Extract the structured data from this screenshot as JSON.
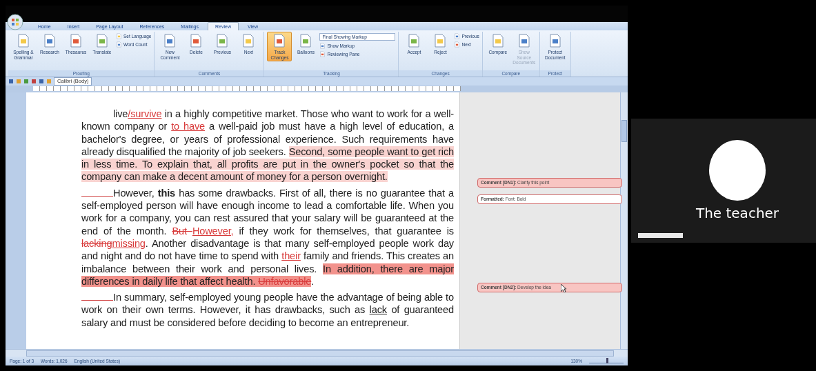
{
  "word_window": {
    "tabs": [
      {
        "label": "Home",
        "selected": false
      },
      {
        "label": "Insert",
        "selected": false
      },
      {
        "label": "Page Layout",
        "selected": false
      },
      {
        "label": "References",
        "selected": false
      },
      {
        "label": "Mailings",
        "selected": false
      },
      {
        "label": "Review",
        "selected": true
      },
      {
        "label": "View",
        "selected": false
      }
    ],
    "ribbon_groups": [
      {
        "label": "Proofing",
        "buttons": [
          {
            "label": "Spelling & Grammar",
            "kind": "large",
            "selected": false,
            "disabled": false
          },
          {
            "label": "Research",
            "kind": "large",
            "selected": false,
            "disabled": false
          },
          {
            "label": "Thesaurus",
            "kind": "large",
            "selected": false,
            "disabled": false
          },
          {
            "label": "Translate",
            "kind": "large",
            "selected": false,
            "disabled": false
          },
          {
            "label": "Set Language",
            "kind": "small",
            "selected": false,
            "disabled": false
          },
          {
            "label": "Word Count",
            "kind": "small",
            "selected": false,
            "disabled": false
          }
        ]
      },
      {
        "label": "Comments",
        "buttons": [
          {
            "label": "New Comment",
            "kind": "large",
            "selected": false,
            "disabled": false
          },
          {
            "label": "Delete",
            "kind": "large",
            "selected": false,
            "disabled": false
          },
          {
            "label": "Previous",
            "kind": "large",
            "selected": false,
            "disabled": false
          },
          {
            "label": "Next",
            "kind": "large",
            "selected": false,
            "disabled": false
          }
        ]
      },
      {
        "label": "Tracking",
        "buttons": [
          {
            "label": "Track Changes",
            "kind": "large",
            "selected": true,
            "disabled": false
          },
          {
            "label": "Balloons",
            "kind": "large",
            "selected": false,
            "disabled": false
          },
          {
            "label": "Final Showing Markup",
            "kind": "dropdown",
            "selected": false,
            "disabled": false
          },
          {
            "label": "Show Markup",
            "kind": "small",
            "selected": false,
            "disabled": false
          },
          {
            "label": "Reviewing Pane",
            "kind": "small",
            "selected": false,
            "disabled": false
          }
        ]
      },
      {
        "label": "Changes",
        "buttons": [
          {
            "label": "Accept",
            "kind": "large",
            "selected": false,
            "disabled": false
          },
          {
            "label": "Reject",
            "kind": "large",
            "selected": false,
            "disabled": false
          },
          {
            "label": "Previous",
            "kind": "small",
            "selected": false,
            "disabled": false
          },
          {
            "label": "Next",
            "kind": "small",
            "selected": false,
            "disabled": false
          }
        ]
      },
      {
        "label": "Compare",
        "buttons": [
          {
            "label": "Compare",
            "kind": "large",
            "selected": false,
            "disabled": false
          },
          {
            "label": "Show Source Documents",
            "kind": "large",
            "selected": false,
            "disabled": true
          }
        ]
      },
      {
        "label": "Protect",
        "buttons": [
          {
            "label": "Protect Document",
            "kind": "large",
            "selected": false,
            "disabled": false
          }
        ]
      }
    ],
    "font_box": "Calibri (Body)",
    "paragraphs": [
      {
        "indent": false,
        "segments": [
          {
            "text": "live",
            "kind": "text"
          },
          {
            "text": "/survive",
            "kind": "ins"
          },
          {
            "text": " in a highly competitive market. Those who want to work for a well-known company or ",
            "kind": "text"
          },
          {
            "text": "to have",
            "kind": "ins"
          },
          {
            "text": " a well-paid job must have a high level of education, a bachelor's degree, or years of professional experience. Such requirements have already disqualified the majority of job seekers. ",
            "kind": "text"
          },
          {
            "text": "Second, some people want to get rich in less time. To explain that, all profits are put in the owner's pocket so that the company can make a decent amount of money for a person overnight.",
            "kind": "text",
            "color": "#f9d3d0"
          }
        ]
      },
      {
        "indent": true,
        "segments": [
          {
            "text": "However, ",
            "kind": "text"
          },
          {
            "text": "this",
            "kind": "bold"
          },
          {
            "text": " has some drawbacks. First of all, there is no guarantee that a self-employed person will have enough income to lead a comfortable life. When you work for a company, you can rest assured that your salary will be guaranteed at the end of the month. ",
            "kind": "text"
          },
          {
            "text": "But ",
            "kind": "del"
          },
          {
            "text": "However,",
            "kind": "ins"
          },
          {
            "text": " if they work for themselves, that guarantee is ",
            "kind": "text"
          },
          {
            "text": "lacking",
            "kind": "del"
          },
          {
            "text": "missing",
            "kind": "ins"
          },
          {
            "text": ". Another disadvantage is that many self-employed people work day and night and do not have time to spend with ",
            "kind": "text"
          },
          {
            "text": "their",
            "kind": "ins"
          },
          {
            "text": " family and friends. This creates an imbalance between their work and personal lives. ",
            "kind": "text"
          },
          {
            "text": "In addition, there are major differences in daily life that affect health. ",
            "kind": "text",
            "color": "#f2928c"
          },
          {
            "text": "Unfavorable",
            "kind": "del",
            "color": "#f2928c"
          },
          {
            "text": ".",
            "kind": "text"
          }
        ]
      },
      {
        "indent": true,
        "segments": [
          {
            "text": "In summary, self-employed young people have the advantage of being able to work on their own terms. However, it has drawbacks, such as ",
            "kind": "text"
          },
          {
            "text": "lack",
            "kind": "underline"
          },
          {
            "text": " of guaranteed salary and must be considered before deciding to become an entrepreneur.",
            "kind": "text"
          }
        ]
      }
    ],
    "balloons": [
      {
        "kind": "comment",
        "text": "**Comment [DN1]:** Clarify this point"
      },
      {
        "kind": "format",
        "text": "**Formatted:** Font: Bold"
      },
      {
        "kind": "comment",
        "text": "**Comment [DN2]:** Develop the idea"
      }
    ],
    "status_bar": {
      "items": [
        "Page: 1 of 3",
        "Words: 1,026",
        "English (United States)"
      ],
      "zoom": "130%",
      "zoom_slider": {
        "level": 0.5
      }
    }
  },
  "participant": {
    "name": "The teacher"
  }
}
